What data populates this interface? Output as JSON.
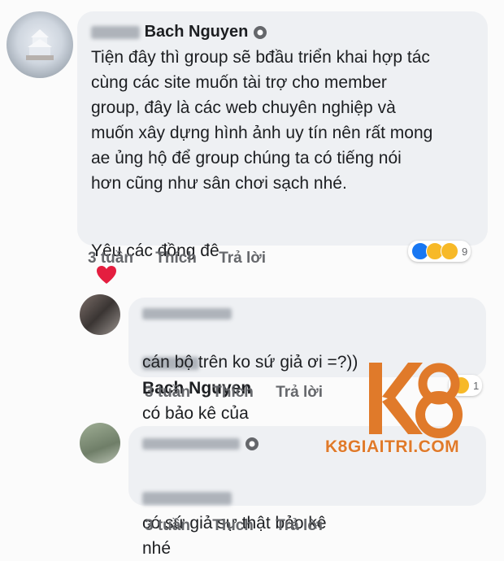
{
  "post": {
    "author_visible": "Bach Nguyen",
    "text": "Tiện đây thì group sẽ bđầu triển khai hợp tác\ncùng các site muốn tài trợ cho member\ngroup, đây là các web chuyên nghiệp và\nmuốn xây dựng hình ảnh uy tín nên rất mong\nae ủng hộ để group chúng ta có tiếng nói\nhơn cũng như sân chơi sạch nhé.",
    "closing": "Yêu các đồng đê",
    "time": "3 tuần",
    "like": "Thích",
    "reply": "Trả lời",
    "reaction_count": "9"
  },
  "reply1": {
    "mention": "Bach Nguyen",
    "text_after_mention": "có bảo kê của",
    "line2": "cán bộ trên ko sứ giả ơi =?))",
    "time": "3 tuần",
    "like": "Thích",
    "reply": "Trả lời",
    "reaction_count": "1"
  },
  "reply2": {
    "text": "có sứ giả sự thật bảo kê\nnhé",
    "time": "3 tuần",
    "like": "Thích",
    "reply": "Trả lời"
  },
  "watermark": {
    "logo": "K8",
    "site": "K8GIAITRI.COM",
    "color": "#e07a2a"
  },
  "colors": {
    "bubble": "#eef0f3",
    "action_text": "#65676b",
    "like_blue": "#1877f2",
    "heart_red": "#e41e3f"
  }
}
